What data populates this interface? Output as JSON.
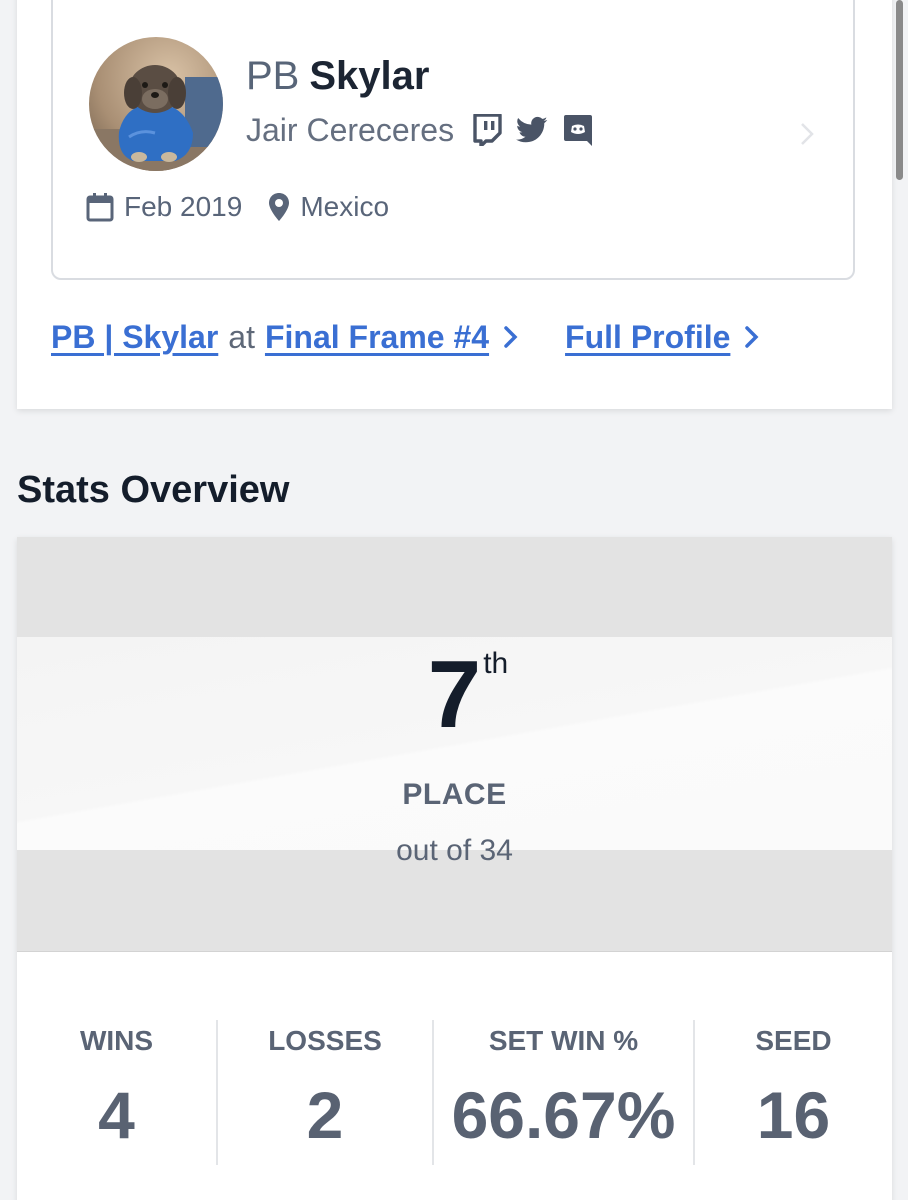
{
  "profile": {
    "prefix": "PB",
    "gamer_tag": "Skylar",
    "real_name": "Jair Cereceres",
    "social_icons": [
      "twitch-icon",
      "twitter-icon",
      "discord-icon"
    ],
    "joined": "Feb 2019",
    "location": "Mexico"
  },
  "links": {
    "entrant_link": "PB | Skylar",
    "at_word": "at",
    "event_link": "Final Frame #4",
    "full_profile": "Full Profile"
  },
  "stats": {
    "section_title": "Stats Overview",
    "placement_number": "7",
    "placement_suffix": "th",
    "placement_label": "PLACE",
    "placement_out_of": "out of 34",
    "items": [
      {
        "label": "WINS",
        "value": "4"
      },
      {
        "label": "LOSSES",
        "value": "2"
      },
      {
        "label": "SET WIN %",
        "value": "66.67%"
      },
      {
        "label": "SEED",
        "value": "16"
      }
    ]
  },
  "colors": {
    "link_blue": "#3a6fd3",
    "heading": "#141d2b",
    "muted": "#5a6475",
    "banner_gray": "#e3e3e3"
  }
}
